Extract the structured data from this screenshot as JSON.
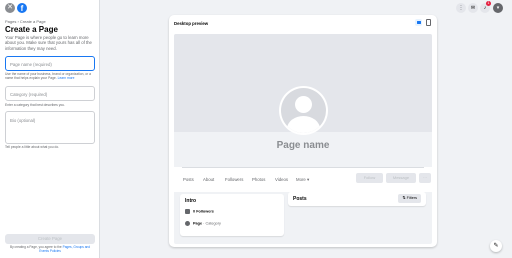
{
  "header": {
    "close_icon": "close-icon",
    "logo": "facebook-logo",
    "breadcrumb": "Pages › Create a Page",
    "title": "Create a Page",
    "intro": "Your Page is where people go to learn more about you. Make sure that yours has all of the information they may need."
  },
  "form": {
    "name_placeholder": "Page name (required)",
    "name_helper": "Use the name of your business, brand or organization, or a name that helps explain your Page.",
    "name_help_link": "Learn more",
    "category_placeholder": "Category (required)",
    "category_helper": "Enter a category that best describes you.",
    "bio_placeholder": "Bio (optional)",
    "bio_helper": "Tell people a little about what you do."
  },
  "footer": {
    "create_label": "Create Page",
    "terms_prefix": "By creating a Page, you agree to the",
    "terms_link": "Pages, Groups and Events Policies"
  },
  "topbar": {
    "icons": [
      "menu-grid-icon",
      "messenger-icon",
      "notifications-icon",
      "account-icon"
    ],
    "notifications_badge": "1"
  },
  "preview": {
    "title": "Desktop preview",
    "page_name": "Page name",
    "tabs": [
      "Posts",
      "About",
      "Followers",
      "Photos",
      "Videos",
      "More ▾"
    ],
    "action_follow": "Follow",
    "action_message": "Message",
    "action_more": "···",
    "intro_heading": "Intro",
    "followers_count": "0",
    "followers_label": "Followers",
    "page_label": "Page",
    "page_category": "Category",
    "posts_heading": "Posts",
    "filters_label": "Filters"
  },
  "colors": {
    "accent": "#1877f2",
    "background": "#f0f2f5",
    "badge": "#e41e3f"
  }
}
